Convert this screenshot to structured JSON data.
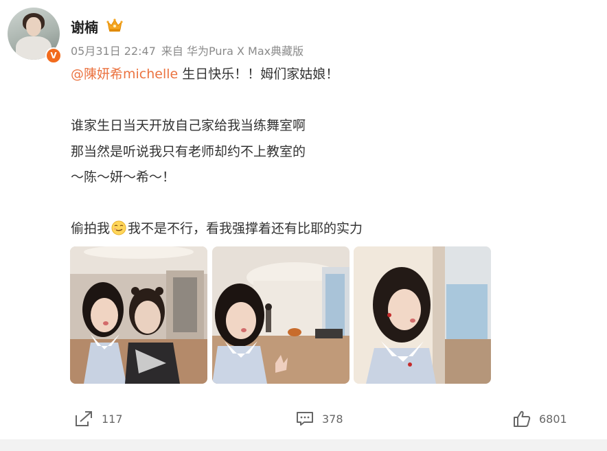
{
  "post": {
    "author": {
      "name": "谢楠",
      "verified_badge": "V",
      "verified_color": "#f26b1d",
      "badge_icon": "crown-icon"
    },
    "meta": {
      "date": "05月31日 22:47",
      "source": "来自 华为Pura X Max典藏版"
    },
    "content": {
      "mention": "@陳妍希michelle",
      "line1_rest": " 生日快乐！！姆们家姑娘！",
      "line2": "谁家生日当天开放自己家给我当练舞室啊",
      "line3": "那当然是听说我只有老师却约不上教室的",
      "line4": "～陈～妍～希～！",
      "line5_start": "偷拍我",
      "line5_emoji": "smirk-emoji-icon",
      "line5_end": "我不是不行，看我强撑着还有比耶的实力",
      "mention_color": "#eb7340"
    },
    "photos": [
      {
        "name": "photo-1",
        "description_icon": "selfie-two-women"
      },
      {
        "name": "photo-2",
        "description_icon": "selfie-peace-sign"
      },
      {
        "name": "photo-3",
        "description_icon": "selfie-profile"
      }
    ],
    "actions": {
      "share": {
        "icon": "share-icon",
        "count": "117"
      },
      "comment": {
        "icon": "comment-icon",
        "count": "378"
      },
      "like": {
        "icon": "thumbs-up-icon",
        "count": "6801"
      }
    }
  }
}
